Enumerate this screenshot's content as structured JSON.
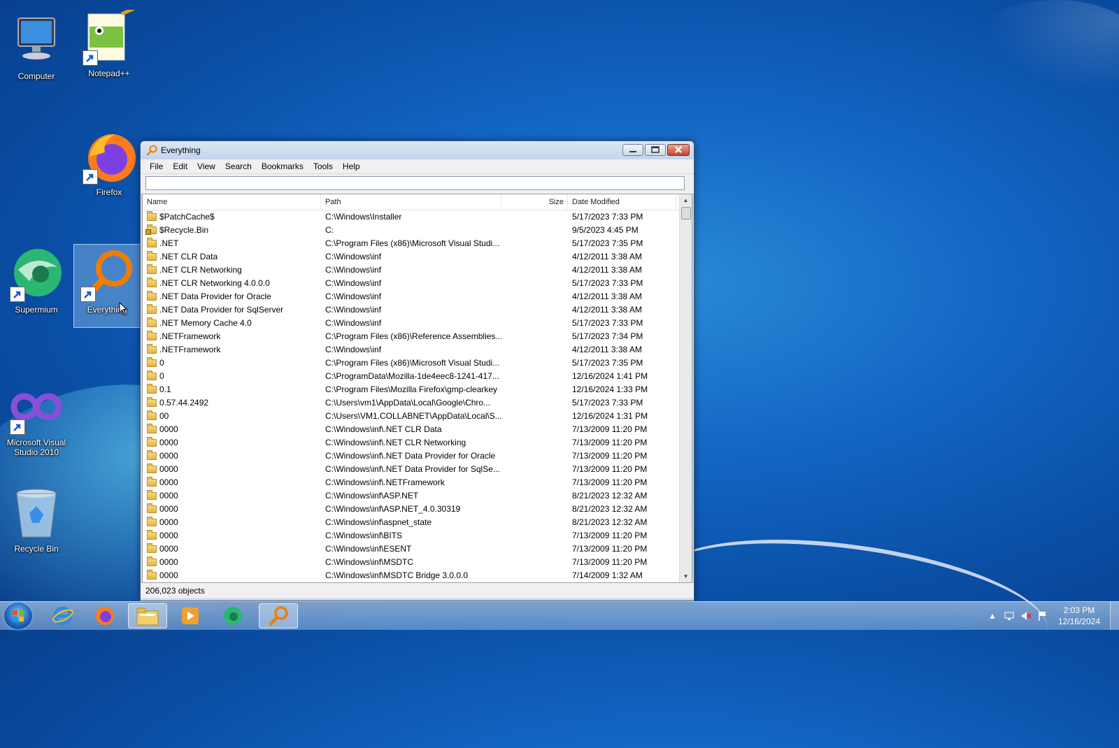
{
  "desktop": {
    "icons": [
      {
        "label": "Computer"
      },
      {
        "label": "Notepad++"
      },
      {
        "label": "Firefox"
      },
      {
        "label": "Supermium"
      },
      {
        "label": "Everything"
      },
      {
        "label": "Microsoft Visual Studio 2010"
      },
      {
        "label": "Recycle Bin"
      }
    ]
  },
  "window": {
    "title": "Everything",
    "menu": [
      "File",
      "Edit",
      "View",
      "Search",
      "Bookmarks",
      "Tools",
      "Help"
    ],
    "search": {
      "value": "",
      "placeholder": ""
    },
    "columns": {
      "name": "Name",
      "path": "Path",
      "size": "Size",
      "date": "Date Modified"
    },
    "rows": [
      {
        "name": "$PatchCache$",
        "path": "C:\\Windows\\Installer",
        "size": "",
        "date": "5/17/2023 7:33 PM"
      },
      {
        "name": "$Recycle.Bin",
        "path": "C:",
        "size": "",
        "date": "9/5/2023 4:45 PM"
      },
      {
        "name": ".NET",
        "path": "C:\\Program Files (x86)\\Microsoft Visual Studi...",
        "size": "",
        "date": "5/17/2023 7:35 PM"
      },
      {
        "name": ".NET CLR Data",
        "path": "C:\\Windows\\inf",
        "size": "",
        "date": "4/12/2011 3:38 AM"
      },
      {
        "name": ".NET CLR Networking",
        "path": "C:\\Windows\\inf",
        "size": "",
        "date": "4/12/2011 3:38 AM"
      },
      {
        "name": ".NET CLR Networking 4.0.0.0",
        "path": "C:\\Windows\\inf",
        "size": "",
        "date": "5/17/2023 7:33 PM"
      },
      {
        "name": ".NET Data Provider for Oracle",
        "path": "C:\\Windows\\inf",
        "size": "",
        "date": "4/12/2011 3:38 AM"
      },
      {
        "name": ".NET Data Provider for SqlServer",
        "path": "C:\\Windows\\inf",
        "size": "",
        "date": "4/12/2011 3:38 AM"
      },
      {
        "name": ".NET Memory Cache 4.0",
        "path": "C:\\Windows\\inf",
        "size": "",
        "date": "5/17/2023 7:33 PM"
      },
      {
        "name": ".NETFramework",
        "path": "C:\\Program Files (x86)\\Reference Assemblies...",
        "size": "",
        "date": "5/17/2023 7:34 PM"
      },
      {
        "name": ".NETFramework",
        "path": "C:\\Windows\\inf",
        "size": "",
        "date": "4/12/2011 3:38 AM"
      },
      {
        "name": "0",
        "path": "C:\\Program Files (x86)\\Microsoft Visual Studi...",
        "size": "",
        "date": "5/17/2023 7:35 PM"
      },
      {
        "name": "0",
        "path": "C:\\ProgramData\\Mozilla-1de4eec8-1241-417...",
        "size": "",
        "date": "12/16/2024 1:41 PM"
      },
      {
        "name": "0.1",
        "path": "C:\\Program Files\\Mozilla Firefox\\gmp-clearkey",
        "size": "",
        "date": "12/16/2024 1:33 PM"
      },
      {
        "name": "0.57.44.2492",
        "path": "C:\\Users\\vm1\\AppData\\Local\\Google\\Chro...",
        "size": "",
        "date": "5/17/2023 7:33 PM"
      },
      {
        "name": "00",
        "path": "C:\\Users\\VM1.COLLABNET\\AppData\\Local\\S...",
        "size": "",
        "date": "12/16/2024 1:31 PM"
      },
      {
        "name": "0000",
        "path": "C:\\Windows\\inf\\.NET CLR Data",
        "size": "",
        "date": "7/13/2009 11:20 PM"
      },
      {
        "name": "0000",
        "path": "C:\\Windows\\inf\\.NET CLR Networking",
        "size": "",
        "date": "7/13/2009 11:20 PM"
      },
      {
        "name": "0000",
        "path": "C:\\Windows\\inf\\.NET Data Provider for Oracle",
        "size": "",
        "date": "7/13/2009 11:20 PM"
      },
      {
        "name": "0000",
        "path": "C:\\Windows\\inf\\.NET Data Provider for SqlSe...",
        "size": "",
        "date": "7/13/2009 11:20 PM"
      },
      {
        "name": "0000",
        "path": "C:\\Windows\\inf\\.NETFramework",
        "size": "",
        "date": "7/13/2009 11:20 PM"
      },
      {
        "name": "0000",
        "path": "C:\\Windows\\inf\\ASP.NET",
        "size": "",
        "date": "8/21/2023 12:32 AM"
      },
      {
        "name": "0000",
        "path": "C:\\Windows\\inf\\ASP.NET_4.0.30319",
        "size": "",
        "date": "8/21/2023 12:32 AM"
      },
      {
        "name": "0000",
        "path": "C:\\Windows\\inf\\aspnet_state",
        "size": "",
        "date": "8/21/2023 12:32 AM"
      },
      {
        "name": "0000",
        "path": "C:\\Windows\\inf\\BITS",
        "size": "",
        "date": "7/13/2009 11:20 PM"
      },
      {
        "name": "0000",
        "path": "C:\\Windows\\inf\\ESENT",
        "size": "",
        "date": "7/13/2009 11:20 PM"
      },
      {
        "name": "0000",
        "path": "C:\\Windows\\inf\\MSDTC",
        "size": "",
        "date": "7/13/2009 11:20 PM"
      },
      {
        "name": "0000",
        "path": "C:\\Windows\\inf\\MSDTC Bridge 3.0.0.0",
        "size": "",
        "date": "7/14/2009 1:32 AM"
      }
    ],
    "status": "206,023 objects"
  },
  "taskbar": {
    "items": [
      "internet-explorer",
      "firefox",
      "file-explorer",
      "media-player",
      "supermium",
      "everything"
    ],
    "clock_time": "2:03 PM",
    "clock_date": "12/16/2024"
  },
  "colors": {
    "desktop": "#1366c4",
    "accent": "#f07d00"
  }
}
